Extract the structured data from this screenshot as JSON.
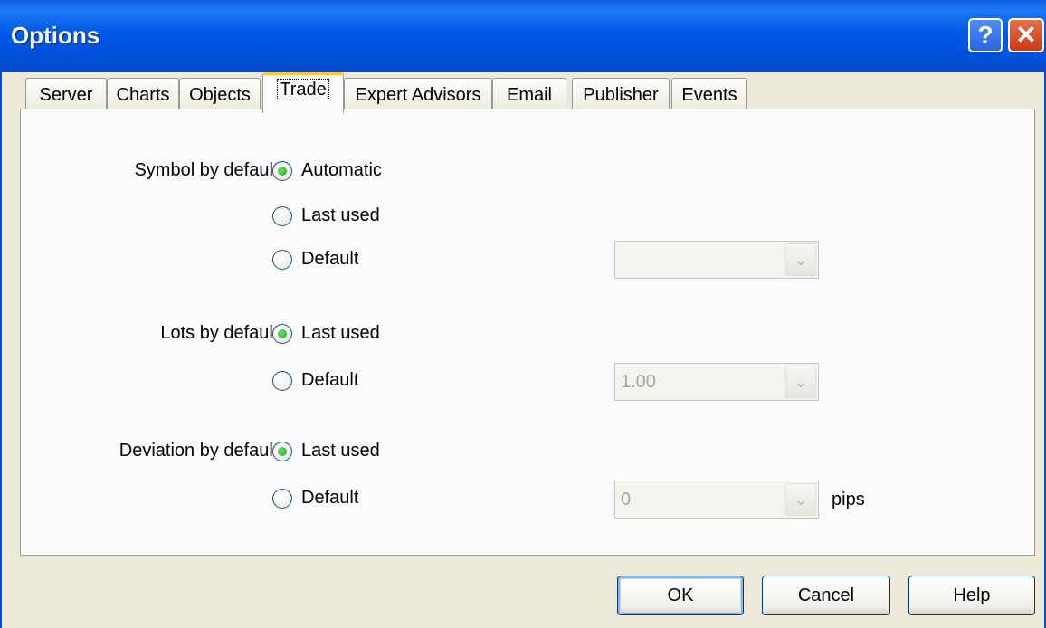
{
  "window": {
    "title": "Options"
  },
  "tabs": [
    "Server",
    "Charts",
    "Objects",
    "Trade",
    "Expert Advisors",
    "Email",
    "Publisher",
    "Events"
  ],
  "active_tab": "Trade",
  "trade": {
    "symbol": {
      "label": "Symbol by default:",
      "options": [
        "Automatic",
        "Last used",
        "Default"
      ],
      "selected": "Automatic",
      "default_value": ""
    },
    "lots": {
      "label": "Lots by default:",
      "options": [
        "Last used",
        "Default"
      ],
      "selected": "Last used",
      "default_value": "1.00"
    },
    "deviation": {
      "label": "Deviation by default:",
      "options": [
        "Last used",
        "Default"
      ],
      "selected": "Last used",
      "default_value": "0",
      "unit": "pips"
    }
  },
  "buttons": {
    "ok": "OK",
    "cancel": "Cancel",
    "help": "Help"
  },
  "icons": {
    "help": "help-icon",
    "close": "close-icon",
    "dropdown": "chevron-down-icon"
  },
  "colors": {
    "titlebar": "#0050d8",
    "close": "#c73a12",
    "active_tab_accent": "#ffc83c",
    "radio_check": "#21a121"
  }
}
